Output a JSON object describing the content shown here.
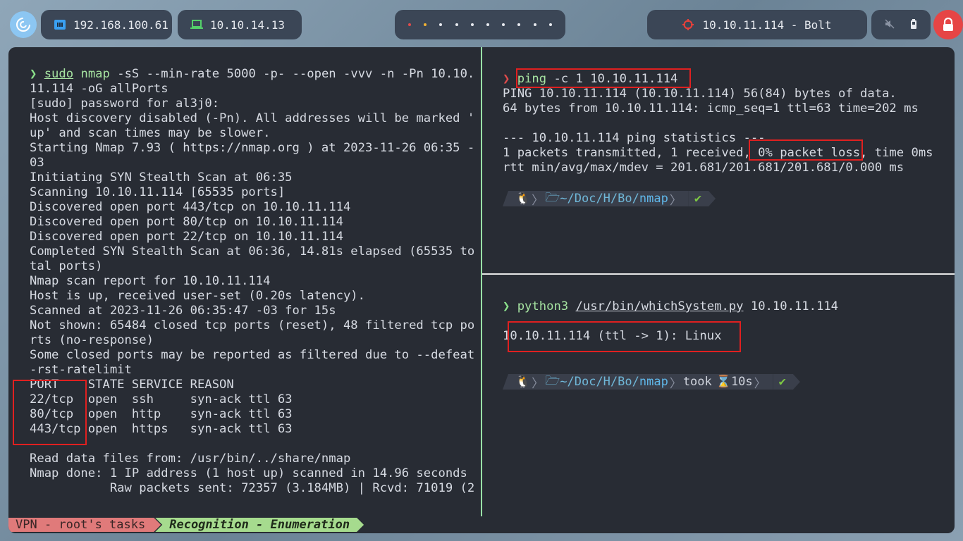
{
  "topbar": {
    "ip_local": "192.168.100.61",
    "ip_vpn": "10.10.14.13",
    "target": "10.10.11.114 - Bolt",
    "workspace_dot_colors": [
      "#e04b4b",
      "#f2b233",
      "#e8eaf0",
      "#e8eaf0",
      "#e8eaf0",
      "#e8eaf0",
      "#e8eaf0",
      "#e8eaf0",
      "#e8eaf0",
      "#e8eaf0"
    ],
    "icons": [
      "debian-logo-icon",
      "ethernet-icon",
      "laptop-icon",
      "crosshair-icon",
      "mute-icon",
      "battery-icon",
      "lock-icon"
    ]
  },
  "left_pane": {
    "lines": [
      "sudo nmap -sS --min-rate 5000 -p- --open -vvv -n -Pn 10.10.",
      "11.114 -oG allPorts",
      "[sudo] password for al3j0:",
      "Host discovery disabled (-Pn). All addresses will be marked '",
      "up' and scan times may be slower.",
      "Starting Nmap 7.93 ( https://nmap.org ) at 2023-11-26 06:35 -",
      "03",
      "Initiating SYN Stealth Scan at 06:35",
      "Scanning 10.10.11.114 [65535 ports]",
      "Discovered open port 443/tcp on 10.10.11.114",
      "Discovered open port 80/tcp on 10.10.11.114",
      "Discovered open port 22/tcp on 10.10.11.114",
      "Completed SYN Stealth Scan at 06:36, 14.81s elapsed (65535 to",
      "tal ports)",
      "Nmap scan report for 10.10.11.114",
      "Host is up, received user-set (0.20s latency).",
      "Scanned at 2023-11-26 06:35:47 -03 for 15s",
      "Not shown: 65484 closed tcp ports (reset), 48 filtered tcp po",
      "rts (no-response)",
      "Some closed ports may be reported as filtered due to --defeat",
      "-rst-ratelimit",
      "PORT    STATE SERVICE REASON",
      "22/tcp  open  ssh     syn-ack ttl 63",
      "80/tcp  open  http    syn-ack ttl 63",
      "443/tcp open  https   syn-ack ttl 63",
      "",
      "Read data files from: /usr/bin/../share/nmap",
      "Nmap done: 1 IP address (1 host up) scanned in 14.96 seconds",
      "           Raw packets sent: 72357 (3.184MB) | Rcvd: 71019 (2"
    ],
    "cmd_sudo": "sudo",
    "cmd_nmap": "nmap",
    "cmd_rest": " -sS --min-rate 5000 -p- --open -vvv -n -Pn 10.10."
  },
  "right_top": {
    "cmd_word": "ping",
    "cmd_rest": " -c 1 10.10.11.114",
    "lines": [
      "PING 10.10.11.114 (10.10.11.114) 56(84) bytes of data.",
      "64 bytes from 10.10.11.114: icmp_seq=1 ttl=63 time=202 ms",
      "",
      "--- 10.10.11.114 ping statistics ---",
      "1 packets transmitted, 1 received, 0% packet loss, time 0ms",
      "rtt min/avg/max/mdev = 201.681/201.681/201.681/0.000 ms"
    ],
    "prompt_path_prefix": "~/Doc/H/Bo/",
    "prompt_path_dir": "nmap"
  },
  "right_bottom": {
    "cmd_word": "python3",
    "cmd_script": "/usr/bin/whichSystem.py",
    "cmd_arg": " 10.10.11.114",
    "output": "10.10.11.114 (ttl -> 1): Linux",
    "prompt_path_prefix": "~/Doc/H/Bo/",
    "prompt_path_dir": "nmap",
    "took_label": "took",
    "took_time": "10s"
  },
  "statusbar": {
    "vpn_label": "VPN - root's tasks",
    "session_label": "Recognition - Enumeration"
  }
}
